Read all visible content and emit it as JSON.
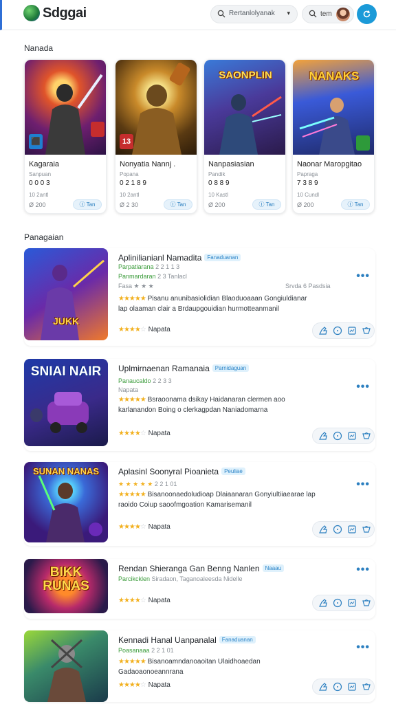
{
  "header": {
    "brand": "Sdggai",
    "search_placeholder": "Rertanlolyanak",
    "search_caret": "▾",
    "user_label": "tem"
  },
  "sections": {
    "featured_title": "Nanada",
    "recommended_title": "Panagaian"
  },
  "featured": [
    {
      "name": "Kagaraia",
      "sub": "Sanpuan",
      "price": "0 0 0 3",
      "meta": "10 2antl",
      "count": "Ø 200",
      "chip": "Ⓘ Tan",
      "art_title": "",
      "badge": ""
    },
    {
      "name": "Nonyatia Nannj .",
      "sub": "Popana",
      "price": "0 2 1 8 9",
      "meta": "10 2antl",
      "count": "Ø 2 30",
      "chip": "Ⓘ Tan",
      "art_title": "",
      "badge": "13"
    },
    {
      "name": "Nanpasiasian",
      "sub": "Pandik",
      "price": "0 8 8 9",
      "meta": "10 Kastl",
      "count": "Ø 200",
      "chip": "Ⓘ Tan",
      "art_title": "SAONPLIN",
      "badge": ""
    },
    {
      "name": "Naonar Maropgitao",
      "sub": "Papraga",
      "price": "7 3 8 9",
      "meta": "10 Cundl",
      "count": "Ø 200",
      "chip": "Ⓘ Tan",
      "art_title": "NANAKS",
      "badge": ""
    }
  ],
  "recommended": [
    {
      "title": "Aplinilianianl Namadita",
      "tag": "Fanaduanan",
      "l1_green": "Parpatiarana",
      "l1_grey": "2 2 1 1 3",
      "l2_green": "Panmardaran",
      "l2_grey": "2 3 Tanlacl",
      "l3": "Fasa ★ ★ ★",
      "side": "Srvda 6 Pasdsia",
      "desc": "Pisanu anunibasiolidian Blaoduoaaan Gongiuldianar lap olaaman clair a Brdaupgouidian hurmotteanmanil",
      "desc_stars": "★★★★★",
      "rating": "Napata",
      "thumb_title": "JUKK"
    },
    {
      "title": "Uplmirnaenan Ramanaia",
      "tag": "Parnidaguan",
      "l1_green": "Panaucaldo",
      "l1_grey": "2 2 3 3",
      "l2_green": "",
      "l2_grey": "Napata",
      "l3": "",
      "side": "",
      "desc": "Bsraoonama dsikay Haidanaran clermen aoo karlanandon Boing o clerkagpdan Naniadomarna",
      "desc_stars": "★★★★★",
      "rating": "Napata",
      "thumb_title": "SNIAI NAIR"
    },
    {
      "title": "Aplasinl Soonyral Pioanieta",
      "tag": "Peuliae",
      "l1_green": "★ ★ ★ ★ ★",
      "l1_grey": "2 2 1 01",
      "l2_green": "",
      "l2_grey": "",
      "l3": "",
      "side": "",
      "desc": "Bisanoonaedoludioap Dlaiaanaran Gonyiultiiaearae lap raoido Coiup saoofmgoation Kamarisemanil",
      "desc_stars": "★★★★★",
      "rating": "Napata",
      "thumb_title": "SUNAN NANAS"
    },
    {
      "title": "Rendan Shieranga Gan Benng Nanlen",
      "tag": "Naaau",
      "l1_green": "Parcikcklen",
      "l1_grey": "Siradaon, Taganoaleesda Nidelle",
      "l2_green": "",
      "l2_grey": "",
      "l3": "",
      "side": "",
      "desc": "",
      "desc_stars": "",
      "rating": "Napata",
      "thumb_title": "BIKK RUNAS"
    },
    {
      "title": "Kennadi Hanal Uanpanalal",
      "tag": "Fanaduanan",
      "l1_green": "Poasanaaa",
      "l1_grey": "2 2 1 01",
      "l2_green": "",
      "l2_grey": "",
      "l3": "",
      "side": "",
      "desc": "Bisanoamndanoaoitan Ulaidhoaedan Gadaoaonoeannrana",
      "desc_stars": "★★★★★",
      "rating": "Napata",
      "thumb_title": ""
    }
  ],
  "colors": {
    "accent": "#1b9ad8",
    "star": "#f2b01e",
    "green": "#3a9b3a"
  }
}
